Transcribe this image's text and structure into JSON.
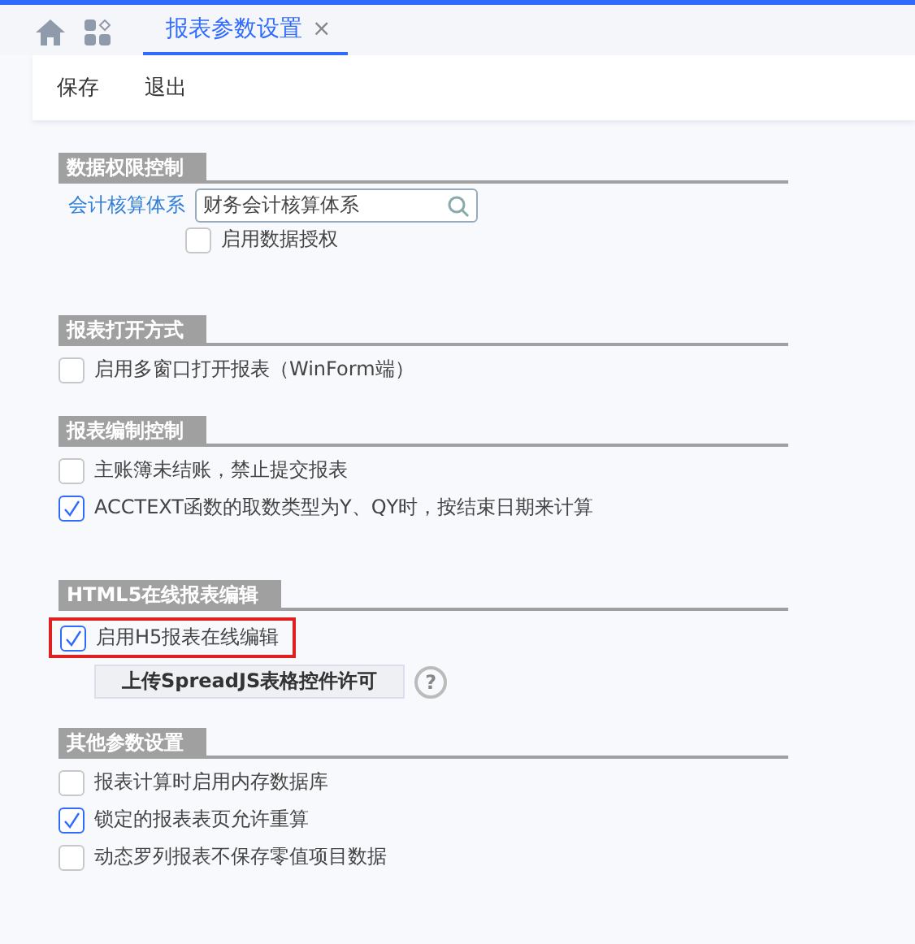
{
  "tabs": [
    {
      "label": "报表参数设置",
      "selected": true,
      "close": "×"
    }
  ],
  "toolbar": [
    "保存",
    "退出"
  ],
  "sections": [
    {
      "title": "数据权限控制",
      "items": [
        {
          "kind": "lookup",
          "label": "会计核算体系",
          "value": "财务会计核算体系"
        },
        {
          "kind": "checkbox",
          "label": "启用数据授权",
          "checked": false,
          "indented": true
        }
      ]
    },
    {
      "title": "报表打开方式",
      "items": [
        {
          "kind": "checkbox",
          "label": "启用多窗口打开报表（WinForm端）",
          "checked": false
        }
      ]
    },
    {
      "title": "报表编制控制",
      "items": [
        {
          "kind": "checkbox",
          "label": "主账簿未结账，禁止提交报表",
          "checked": false
        },
        {
          "kind": "checkbox",
          "label": "ACCTEXT函数的取数类型为Y、QY时，按结束日期来计算",
          "checked": true
        }
      ]
    },
    {
      "title": "HTML5在线报表编辑",
      "items": [
        {
          "kind": "checkbox",
          "label": "启用H5报表在线编辑",
          "checked": true,
          "highlighted": true
        },
        {
          "kind": "button",
          "label": "上传SpreadJS表格控件许可",
          "help": "?"
        }
      ]
    },
    {
      "title": "其他参数设置",
      "items": [
        {
          "kind": "checkbox",
          "label": "报表计算时启用内存数据库",
          "checked": false
        },
        {
          "kind": "checkbox",
          "label": "锁定的报表表页允许重算",
          "checked": true
        },
        {
          "kind": "checkbox",
          "label": "动态罗列报表不保存零值项目数据",
          "checked": false
        }
      ]
    }
  ]
}
